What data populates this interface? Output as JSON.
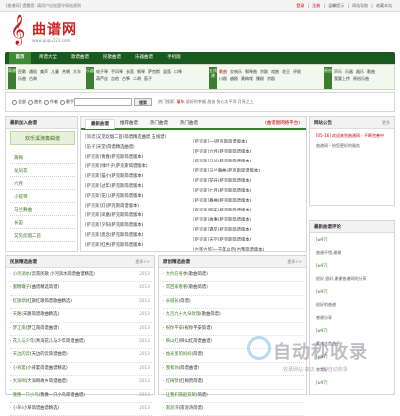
{
  "topbar": {
    "notice": "[曲谱网] 提醒您: 请用户自觉遵守网站规则",
    "links": [
      "登录",
      "|",
      "注册",
      "|",
      "温馨提示",
      "|",
      "网站导航",
      "|",
      "收藏本站"
    ]
  },
  "logo": {
    "glyph": "𝄞",
    "name": "曲谱网",
    "url": "www.qupu123.com"
  },
  "nav": {
    "items": [
      "首页",
      "简谱大全",
      "歌谱曲谱",
      "民歌曲谱",
      "乐器曲谱",
      "手机版"
    ]
  },
  "subnav": {
    "groups": [
      {
        "tag": "简谱",
        "links": [
          "民歌",
          "通俗",
          "美声",
          "儿童",
          "合唱",
          "大伞",
          "乐曲",
          "古典"
        ]
      },
      {
        "tag": "乐器",
        "links": [
          "电子琴",
          "手风琴",
          "长笛",
          "钢琴",
          "萨克斯",
          "竖笛",
          "口琴",
          "葫芦丝",
          "吉他",
          "古筝",
          "二胡",
          "笛子"
        ]
      },
      {
        "tag": "五线谱",
        "links": [
          "歌曲",
          "交响乐",
          "钢琴曲",
          "京剧",
          "戏曲",
          "花旦",
          "评剧",
          "川剧",
          "越剧",
          "黄梅戏",
          "豫剧",
          "京剧"
        ]
      },
      {
        "tag": "原创",
        "links": [
          "声乐",
          "乐器",
          "器乐",
          "歌曲",
          "我要上传",
          "原创乐曲"
        ]
      }
    ]
  },
  "search": {
    "options": [
      "全部",
      "曲名",
      "作者",
      "歌手"
    ],
    "placeholder": "",
    "button": "搜索",
    "hot_label": "热门搜索:",
    "hot_terms": [
      "童年",
      "说好的幸福",
      "加油",
      "伤心太平洋",
      "月亮之上"
    ]
  },
  "latest": {
    "title": "最新加入曲谱",
    "more": "更多>>",
    "banner": "欢乐溪演奏曲谱",
    "side_items": [
      "黄梅",
      "龙凤花",
      "六月",
      "小提琴",
      "马兰舞曲",
      "长笛",
      "又见炊烟二首"
    ]
  },
  "tabs": {
    "items": [
      "最新曲谱",
      "推荐曲谱",
      "热门曲谱",
      "热门曲谱"
    ],
    "note": "(曲谱图网络平台)"
  },
  "songs": [
    {
      "c": "[简谱]",
      "s": "又见炊烟二首(简谱精选曲谱 五线谱)",
      "c2": "[萨克斯]",
      "s2": "一(萨克斯简谱版本)"
    },
    {
      "c": "[笛子]",
      "s": "天堂(简谱精选曲谱)",
      "c2": "[萨克斯]",
      "s2": "六月(萨克斯简谱版本)"
    },
    {
      "c": "[萨克斯]",
      "s": "青春(萨克斯简谱版本)",
      "c2": "[萨克斯]",
      "s2": "马兰(萨克斯简谱版本)"
    },
    {
      "c": "[萨克斯]",
      "s": "绿叶子(萨克斯简谱版本)",
      "c2": "[萨克斯]",
      "s2": "马兰舞曲(萨克斯简谱版本)"
    },
    {
      "c": "[萨克斯]",
      "s": "猫小(萨克斯简谱版本)",
      "c2": "[萨克斯]",
      "s2": "花开(萨克斯简谱版本)"
    },
    {
      "c": "[萨克斯]",
      "s": "过年(萨克斯简谱版本)",
      "c2": "[萨克斯]",
      "s2": "七月(萨克斯简谱版本)"
    },
    {
      "c": "[萨克斯]",
      "s": "花儿(萨克斯简谱版本)",
      "c2": "[萨克斯]",
      "s2": "舞曲(萨克斯简谱版本)"
    },
    {
      "c": "[萨克斯]",
      "s": "灯(萨克斯简谱版本)",
      "c2": "[萨克斯]",
      "s2": "明天(萨克斯简谱版本)"
    },
    {
      "c": "[萨克斯]",
      "s": "凤凰(萨克斯简谱版本)",
      "c2": "[萨克斯]",
      "s2": "故事(萨克斯简谱版本)"
    },
    {
      "c": "[萨克斯]",
      "s": "夕阳(萨克斯简谱版本)",
      "c2": "[萨克斯]",
      "s2": "遇见(萨克斯简谱版本)"
    },
    {
      "c": "[萨克斯]",
      "s": "思念(萨克斯简谱版本)",
      "c2": "[萨克斯]",
      "s2": "天空(萨克斯简谱版本)"
    },
    {
      "c": "[萨克斯]",
      "s": "红色(萨克斯简谱版本)",
      "c2": "[古筝古琴]",
      "s2": "一千年以后(古筝简谱版本)"
    }
  ],
  "announcement": {
    "title": "网站公告",
    "more": "更多",
    "text1": "[05-16] 欢迎来到曲谱网 - 不断完善中",
    "text2": "曲谱网 - 给您更好的服务"
  },
  "left_list": {
    "title": "民族精选曲谱",
    "more": "更多>>",
    "items": [
      {
        "n": "小河淌水",
        "d": "(云南民歌 小河淌水简谱曲谱精选)",
        "cnt": "2013"
      },
      {
        "n": "蜜糖罐子",
        "d": "(曲谱精选简谱)",
        "cnt": "2013"
      },
      {
        "n": "红旗颂",
        "d": "(红旗红歌简谱歌曲精选)",
        "cnt": "2013"
      },
      {
        "n": "天路",
        "d": "(天路简谱歌曲精选)",
        "cnt": "2013"
      },
      {
        "n": "梦江南",
        "d": "(梦江南简谱曲谱)",
        "cnt": "2013"
      },
      {
        "n": "花儿与少年",
        "d": "(青海花儿与少年简谱曲谱)",
        "cnt": "2013"
      },
      {
        "n": "天边的云",
        "d": "(天边的云简谱曲谱)",
        "cnt": "2013"
      },
      {
        "n": "小背篓",
        "d": "(小背篓简谱曲谱精选)",
        "cnt": "2013"
      },
      {
        "n": "大海啊",
        "d": "(大海啊故乡简谱曲谱)",
        "cnt": "2013"
      },
      {
        "n": "我像一只小鸟",
        "d": "(我像一只小鸟简谱曲谱)",
        "cnt": "2013"
      },
      {
        "n": "小草",
        "d": "(小草简谱曲谱精选)",
        "cnt": "2013"
      }
    ]
  },
  "right_list": {
    "title": "原创精选曲谱",
    "more": "更多>>",
    "items": [
      {
        "n": "大约在冬季",
        "d": "(歌曲简谱)",
        "cnt": ""
      },
      {
        "n": "常回家看看",
        "d": "(歌曲简谱)",
        "cnt": ""
      },
      {
        "n": "长城长",
        "d": "(简谱)",
        "cnt": ""
      },
      {
        "n": "九百九十九朵玫瑰",
        "d": "(歌曲简谱)",
        "cnt": ""
      },
      {
        "n": "祝你平安",
        "d": "(祝你平安简谱)",
        "cnt": ""
      },
      {
        "n": "映山红",
        "d": "(映山红简谱曲谱)",
        "cnt": ""
      },
      {
        "n": "烛光里的妈妈",
        "d": "(简谱)",
        "cnt": ""
      },
      {
        "n": "我和你",
        "d": "(简谱曲谱)",
        "cnt": ""
      },
      {
        "n": "红梅赞",
        "d": "(红梅赞简谱)",
        "cnt": ""
      },
      {
        "n": "让我们荡起双桨",
        "d": "(简谱)",
        "cnt": ""
      },
      {
        "n": "南泥湾",
        "d": "(南泥湾简谱)",
        "cnt": ""
      }
    ]
  },
  "comments": {
    "title": "最新曲谱评论",
    "items": [
      "[w97]",
      "曲谱不错,谢谢",
      "[w97]",
      "很好,很好,谢谢曲谱网的分享",
      "[w97]",
      "很好的曲谱",
      "感谢分享",
      "[w97]",
      "喜欢这首曲子",
      "[w97]",
      "非常好",
      "[w97]"
    ]
  },
  "watermark": {
    "title": "自动秒收录",
    "sub": "收录网站·来访·一次·自动收录"
  }
}
